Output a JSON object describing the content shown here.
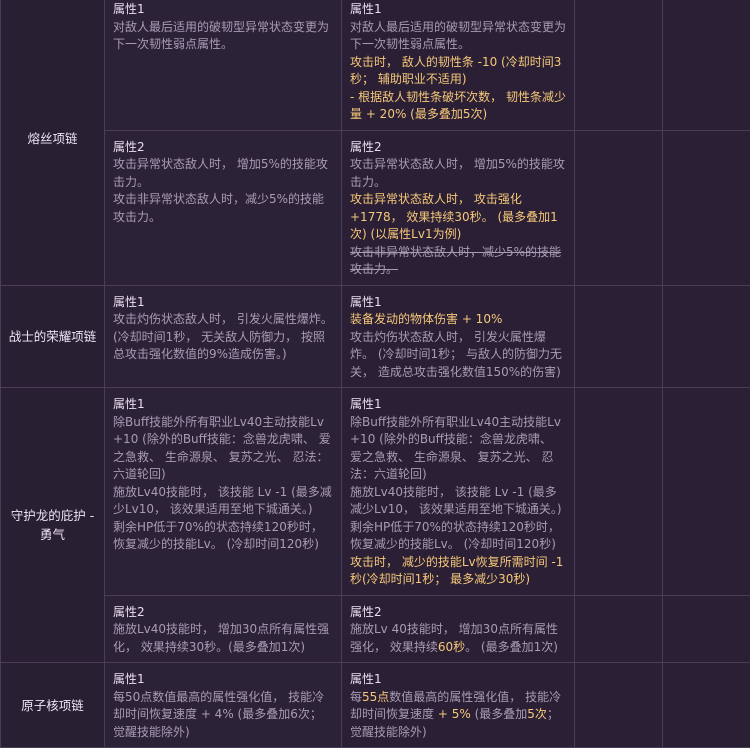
{
  "rows": [
    {
      "name": "熔丝项链",
      "sections": [
        {
          "old": {
            "title": "属性1",
            "lines": [
              "对敌人最后适用的破韧型异常状态变更为下一次韧性弱点属性。"
            ]
          },
          "new": {
            "title": "属性1",
            "lines": [
              {
                "text": "对敌人最后适用的破韧型异常状态变更为下一次韧性弱点属性。",
                "style": "normal"
              },
              {
                "text": "攻击时， 敌人的韧性条 -10 (冷却时间3秒； 辅助职业不适用)",
                "style": "hl"
              },
              {
                "text": "- 根据敌人韧性条破坏次数， 韧性条减少量 + 20% (最多叠加5次)",
                "style": "hl"
              }
            ]
          }
        },
        {
          "old": {
            "title": "属性2",
            "lines": [
              "攻击异常状态敌人时， 增加5%的技能攻击力。",
              "攻击非异常状态敌人时，减少5%的技能攻击力。"
            ]
          },
          "new": {
            "title": "属性2",
            "lines": [
              {
                "text": "攻击异常状态敌人时， 增加5%的技能攻击力。",
                "style": "normal"
              },
              {
                "text": "攻击异常状态敌人时， 攻击强化 +1778， 效果持续30秒。 (最多叠加1次) (以属性Lv1为例)",
                "style": "hl"
              },
              {
                "text": "攻击非异常状态敌人时，减少5%的技能攻击力。",
                "style": "strike"
              }
            ]
          }
        }
      ]
    },
    {
      "name": "战士的荣耀项链",
      "sections": [
        {
          "old": {
            "title": "属性1",
            "lines": [
              "攻击灼伤状态敌人时， 引发火属性爆炸。 (冷却时间1秒， 无关敌人防御力， 按照总攻击强化数值的9%造成伤害。)"
            ]
          },
          "new": {
            "title": "属性1",
            "lines": [
              {
                "text": "装备发动的物体伤害 + 10%",
                "style": "hl"
              },
              {
                "text": "攻击灼伤状态敌人时， 引发火属性爆炸。 (冷却时间1秒； 与敌人的防御力无关， 造成总攻击强化数值150%的伤害)",
                "style": "normal"
              }
            ]
          }
        }
      ]
    },
    {
      "name": "守护龙的庇护 - 勇气",
      "sections": [
        {
          "old": {
            "title": "属性1",
            "lines": [
              "除Buff技能外所有职业Lv40主动技能Lv +10 (除外的Buff技能：念兽龙虎啸、 爱之急救、 生命源泉、 复苏之光、 忍法：六道轮回)",
              "施放Lv40技能时， 该技能 Lv -1 (最多减少Lv10， 该效果适用至地下城通关。)",
              "剩余HP低于70%的状态持续120秒时， 恢复减少的技能Lv。 (冷却时间120秒)"
            ]
          },
          "new": {
            "title": "属性1",
            "lines": [
              {
                "text": "除Buff技能外所有职业Lv40主动技能Lv +10 (除外的Buff技能：念兽龙虎啸、 爱之急救、 生命源泉、 复苏之光、 忍法：六道轮回)",
                "style": "normal"
              },
              {
                "text": "施放Lv40技能时， 该技能 Lv -1 (最多减少Lv10， 该效果适用至地下城通关。)",
                "style": "normal"
              },
              {
                "text": "剩余HP低于70%的状态持续120秒时， 恢复减少的技能Lv。 (冷却时间120秒)",
                "style": "normal"
              },
              {
                "text": "攻击时， 减少的技能Lv恢复所需时间 -1秒(冷却时间1秒； 最多减少30秒)",
                "style": "hl"
              }
            ]
          }
        },
        {
          "old": {
            "title": "属性2",
            "lines": [
              "施放Lv40技能时， 增加30点所有属性强化， 效果持续30秒。(最多叠加1次)"
            ]
          },
          "new": {
            "title": "属性2",
            "lines": [
              {
                "text": "施放Lv 40技能时， 增加30点所有属性强化， 效果持续",
                "style": "normal"
              },
              {
                "text": "60秒",
                "style": "hl",
                "inline": true
              },
              {
                "text": "。 (最多叠加1次)",
                "style": "normal",
                "inline": true
              }
            ]
          }
        }
      ]
    },
    {
      "name": "原子核项链",
      "sections": [
        {
          "old": {
            "title": "属性1",
            "lines": [
              "每50点数值最高的属性强化值， 技能冷却时间恢复速度 + 4% (最多叠加6次； 觉醒技能除外)"
            ]
          },
          "new": {
            "title": "属性1",
            "lines": [
              {
                "text": "每",
                "style": "normal"
              },
              {
                "text": "55点",
                "style": "hl",
                "inline": true
              },
              {
                "text": "数值最高的属性强化值， 技能冷却时间恢复速度",
                "style": "normal",
                "inline": true
              },
              {
                "text": " + 5%",
                "style": "hl",
                "inline": true
              },
              {
                "text": " (最多叠加",
                "style": "normal",
                "inline": true
              },
              {
                "text": "5次",
                "style": "hl",
                "inline": true
              },
              {
                "text": "； 觉醒技能除外)",
                "style": "normal",
                "inline": true
              }
            ]
          }
        }
      ]
    }
  ]
}
